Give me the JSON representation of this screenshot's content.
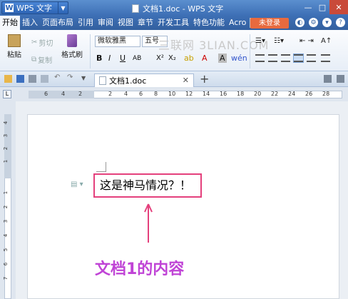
{
  "titlebar": {
    "app_name": "WPS 文字",
    "window_title": "文档1.doc - WPS 文字"
  },
  "menubar": {
    "items": [
      "开始",
      "插入",
      "页面布局",
      "引用",
      "审阅",
      "视图",
      "章节",
      "开发工具",
      "特色功能",
      "Acro"
    ],
    "login_label": "未登录"
  },
  "ribbon": {
    "cut_label": "剪切",
    "copy_label": "复制",
    "paste_label": "粘贴",
    "format_painter_label": "格式刷",
    "font_name": "微软雅黑",
    "font_size": "五号",
    "watermark": "三联网 3LIAN.COM"
  },
  "tabbar": {
    "doc_tab_label": "文档1.doc"
  },
  "ruler": {
    "h_ticks": [
      "6",
      "4",
      "2",
      "2",
      "4",
      "6",
      "8",
      "10",
      "12",
      "14",
      "16",
      "18",
      "20",
      "22",
      "24",
      "26",
      "28"
    ],
    "v_ticks": [
      "4",
      "3",
      "2",
      "1",
      "1",
      "2",
      "3",
      "4",
      "5",
      "6",
      "7"
    ]
  },
  "document": {
    "content_text": "这是神马情况？！",
    "annotation": "文档1的内容"
  },
  "colors": {
    "highlight_box": "#e4407c",
    "annotation": "#c044d6",
    "login_button": "#e86a3e"
  }
}
